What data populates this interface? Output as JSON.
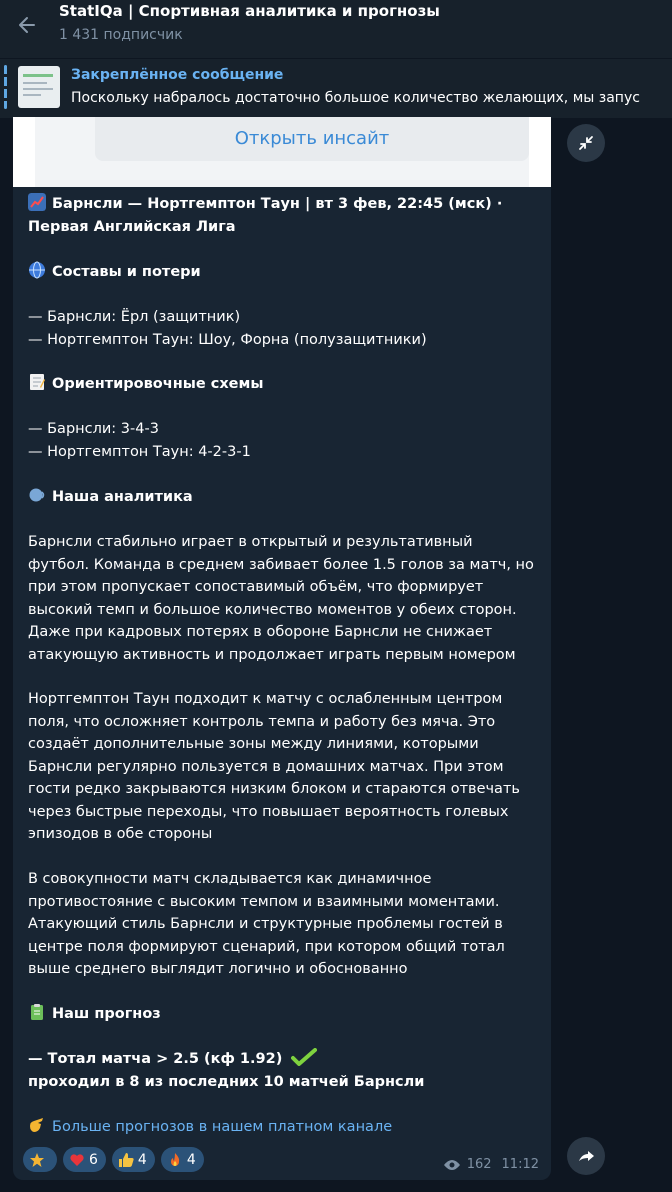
{
  "header": {
    "title": "StatIQa | Спортивная аналитика и прогнозы",
    "subscribers": "1 431 подписчик"
  },
  "pinned": {
    "label": "Закреплённое сообщение",
    "text": "Поскольку набралось достаточно большое количество желающих, мы запус"
  },
  "message": {
    "preview_button": "Открыть инсайт",
    "match_line1": "Барнсли — Нортгемптон Таун | вт 3 фев, 22:45 (мск) ·",
    "match_line2": "Первая Английская Лига",
    "lineups_title": "Составы и потери",
    "lineup1": "— Барнсли: Ёрл (защитник)",
    "lineup2": "— Нортгемптон Таун: Шоу, Форна (полузащитники)",
    "schemes_title": "Ориентировочные схемы",
    "scheme1": "— Барнсли: 3-4-3",
    "scheme2": "— Нортгемптон Таун: 4-2-3-1",
    "analytics_title": "Наша аналитика",
    "p1": [
      "Барнсли стабильно играет в открытый и результативный",
      "футбол. Команда в среднем забивает более 1.5 голов за матч, но",
      "при этом пропускает сопоставимый объём, что формирует",
      "высокий темп и большое количество моментов у обеих сторон.",
      "Даже при кадровых потерях в обороне Барнсли не снижает",
      "атакующую активность и продолжает играть первым номером"
    ],
    "p2": [
      "Нортгемптон Таун подходит к матчу с ослабленным центром",
      "поля, что осложняет контроль темпа и работу без мяча. Это",
      "создаёт дополнительные зоны между линиями, которыми",
      "Барнсли регулярно пользуется в домашних матчах. При этом",
      "гости редко закрываются низким блоком и стараются отвечать",
      "через быстрые переходы, что повышает вероятность голевых",
      "эпизодов в обе стороны"
    ],
    "p3": [
      "В совокупности матч складывается как динамичное",
      "противостояние с высоким темпом и взаимными моментами.",
      "Атакующий стиль Барнсли и структурные проблемы гостей в",
      "центре поля формируют сценарий, при котором общий тотал",
      "выше среднего выглядит логично и обоснованно"
    ],
    "forecast_title": "Наш прогноз",
    "forecast_line1": "— Тотал матча > 2.5 (кф 1.92)",
    "forecast_line2": "проходил в 8 из последних 10 матчей Барнсли",
    "more_link": "Больше прогнозов в нашем платном канале",
    "reactions": [
      {
        "icon": "star-icon",
        "count": ""
      },
      {
        "icon": "heart-icon",
        "count": "6"
      },
      {
        "icon": "thumbs-up-icon",
        "count": "4"
      },
      {
        "icon": "fire-icon",
        "count": "4"
      }
    ],
    "views": "162",
    "time": "11:12"
  },
  "colors": {
    "background": "#0e1621",
    "header": "#17212b",
    "bubble": "#182533",
    "accent": "#6ab3f3",
    "reaction": "#2b5278"
  }
}
